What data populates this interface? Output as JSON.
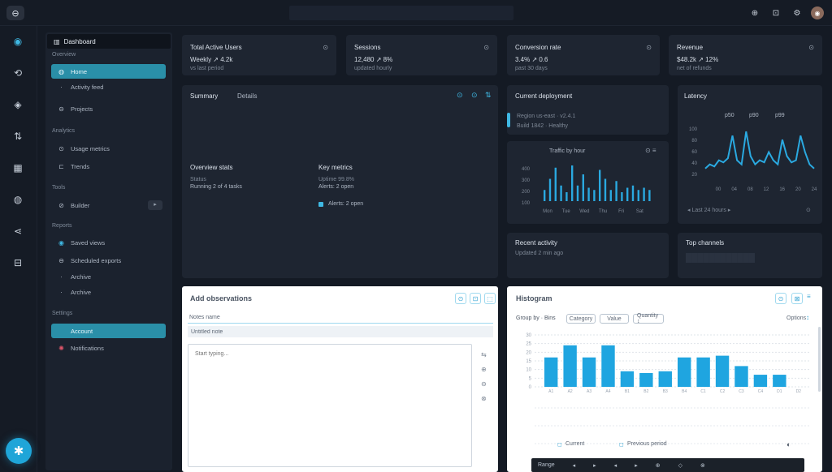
{
  "topbar": {
    "logo": "⊖",
    "actions": [
      "⊕",
      "⊡",
      "⚙",
      "◉"
    ]
  },
  "rail": {
    "items": [
      "◉",
      "⟲",
      "◈",
      "⇅",
      "▦",
      "◍",
      "⋖",
      "⊟"
    ],
    "fab": "✱"
  },
  "sidebar": {
    "header_icon": "▥",
    "header": "Dashboard",
    "sections": [
      "Overview",
      "Analytics",
      "Tools",
      "Reports",
      "Settings"
    ],
    "items": [
      {
        "label": "Home",
        "icon": "◍",
        "active": true
      },
      {
        "label": "Activity feed",
        "icon": "·",
        "active": false
      },
      {
        "label": "Projects",
        "icon": "⊖",
        "active": false
      },
      {
        "label": "Usage metrics",
        "icon": "⊙",
        "active": false
      },
      {
        "label": "Trends",
        "icon": "⊏",
        "active": false
      },
      {
        "label": "Builder",
        "icon": "⊘",
        "active": false,
        "badge": "▸"
      },
      {
        "label": "Saved views",
        "icon": "◉",
        "active": false
      },
      {
        "label": "Scheduled exports",
        "icon": "⊖",
        "active": false
      },
      {
        "label": "Archive",
        "icon": "·",
        "active": false
      },
      {
        "label": "Account",
        "icon": "",
        "active": true
      },
      {
        "label": "Notifications",
        "icon": "✺",
        "active": false
      }
    ]
  },
  "kpis": [
    {
      "title": "Total Active Users",
      "icon": "⊙",
      "value": "Weekly ↗ 4.2k",
      "sub": "vs last period"
    },
    {
      "title": "Sessions",
      "icon": "⊙",
      "value": "12,480 ↗ 8%",
      "sub": "updated hourly"
    },
    {
      "title": "Conversion rate",
      "icon": "⊙",
      "value": "3.4% ↗ 0.6",
      "sub": "past 30 days"
    },
    {
      "title": "Revenue",
      "icon": "⊙",
      "value": "$48.2k ↗ 12%",
      "sub": "net of refunds"
    }
  ],
  "summary": {
    "tabs": [
      "Summary",
      "Details"
    ],
    "tools": [
      "⊙",
      "⊙",
      "⇅"
    ],
    "col1": {
      "title": "Overview stats",
      "l1": "Status",
      "l2": "Running 2 of 4 tasks"
    },
    "col2": {
      "title": "Key metrics",
      "l1": "Uptime 99.8%",
      "l2": "Alerts: 2 open"
    }
  },
  "info": {
    "title": "Current deployment",
    "line1": "Region us-east · v2.4.1",
    "line2": "Build 1842 · Healthy"
  },
  "mini_chart": {
    "title": "Traffic by hour",
    "legend_icon": "⊙ ≡",
    "ylabels": [
      "400",
      "300",
      "200",
      "100"
    ],
    "xlabels": [
      "Mon",
      "Tue",
      "Wed",
      "Thu",
      "Fri",
      "Sat"
    ],
    "values": [
      10,
      20,
      30,
      14,
      8,
      32,
      14,
      24,
      12,
      10,
      28,
      20,
      10,
      18,
      8,
      12,
      14,
      10,
      12,
      10
    ]
  },
  "line_card": {
    "title": "Latency",
    "legend": [
      "p50",
      "p90",
      "p99"
    ],
    "ylabels": [
      "100",
      "80",
      "60",
      "40",
      "20"
    ],
    "xlabels": [
      "00",
      "04",
      "08",
      "12",
      "16",
      "20",
      "24"
    ],
    "footer": "◂ Last 24 hours ▸",
    "footer_icon": "⊙",
    "values": [
      6,
      8,
      7,
      10,
      9,
      11,
      22,
      10,
      8,
      24,
      12,
      8,
      10,
      9,
      14,
      10,
      8,
      20,
      12,
      9,
      10,
      22,
      14,
      8,
      6
    ]
  },
  "bottom_left": {
    "title": "Recent activity",
    "sub": "Updated 2 min ago"
  },
  "bottom_right": {
    "title": "Top channels",
    "blurred": "████████████"
  },
  "notes": {
    "title": "Add observations",
    "field_label": "Notes name",
    "field_value": "Untitled note",
    "text_placeholder": "Start typing...",
    "tools": [
      "⊙",
      "⊡",
      "⬚"
    ],
    "side": [
      "⇆",
      "⊕",
      "⊖",
      "⊗"
    ]
  },
  "bar_panel": {
    "title": "Histogram",
    "tools": [
      "⊙",
      "⊠",
      "≡"
    ],
    "controls_label": "Group by · Bins",
    "pills": [
      "Category",
      "Value",
      "Quantity ↕"
    ],
    "right_label": "Options",
    "right_icon": "↕",
    "legend": [
      "Current",
      "Previous period"
    ],
    "legend_marks": [
      "◻",
      "◻"
    ],
    "toggle": "◐",
    "footer": [
      "Range",
      "◂",
      "▸",
      "◂",
      "▸",
      "⊕",
      "◇",
      "⊗"
    ],
    "ylabels": [
      "30",
      "25",
      "20",
      "15",
      "10",
      "5",
      "0"
    ],
    "xlabels": [
      "A1",
      "A2",
      "A3",
      "A4",
      "B1",
      "B2",
      "B3",
      "B4",
      "C1",
      "C2",
      "C3",
      "C4",
      "D1",
      "D2"
    ],
    "values": [
      17,
      24,
      17,
      24,
      9,
      8,
      9,
      17,
      17,
      18,
      12,
      7,
      7,
      0
    ]
  }
}
